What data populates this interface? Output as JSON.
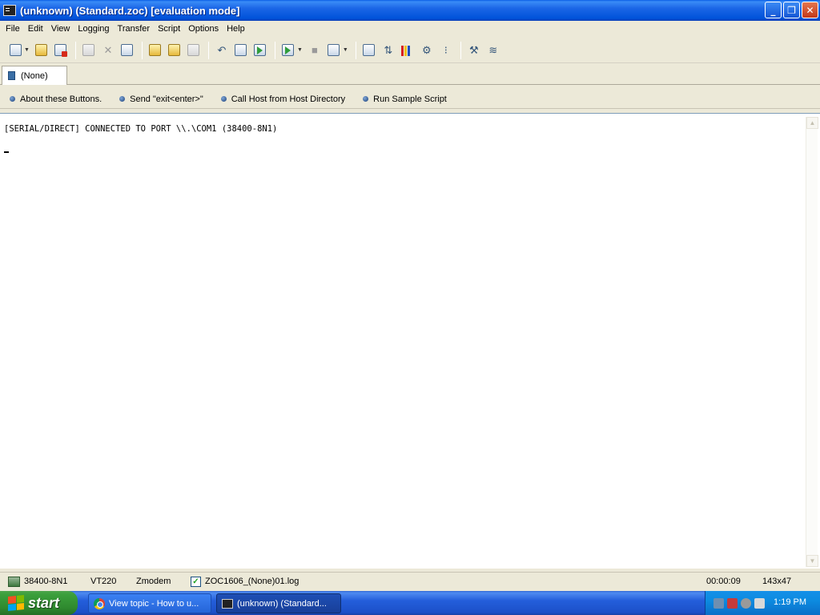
{
  "window": {
    "title": "(unknown) (Standard.zoc) [evaluation mode]",
    "controls": [
      "minimize",
      "restore",
      "close"
    ]
  },
  "menu": [
    "File",
    "Edit",
    "View",
    "Logging",
    "Transfer",
    "Script",
    "Options",
    "Help"
  ],
  "toolbar": {
    "icons": [
      "quick-connect-icon",
      "address-book-icon",
      "disconnect-icon",
      "copy-icon",
      "cut-icon",
      "paste-icon",
      "paste-clipboard-icon",
      "edit-icon",
      "print-icon",
      "send-file-icon",
      "upload-icon",
      "download-icon",
      "run-script-icon",
      "stop-icon",
      "edit-script-icon",
      "settings-icon",
      "transfer-settings-icon",
      "color-settings-icon",
      "keyboard-settings-icon",
      "mapping-icon",
      "tools-icon",
      "trace-icon"
    ]
  },
  "tabs": [
    {
      "label": "(None)"
    }
  ],
  "quick_buttons": [
    {
      "label": "About these Buttons."
    },
    {
      "label": "Send \"exit<enter>\""
    },
    {
      "label": "Call Host from Host Directory"
    },
    {
      "label": "Run Sample Script"
    }
  ],
  "terminal": {
    "lines": [
      "[SERIAL/DIRECT] CONNECTED TO PORT \\\\.\\COM1 (38400-8N1)"
    ]
  },
  "status": {
    "connection": "38400-8N1",
    "emulation": "VT220",
    "protocol": "Zmodem",
    "log_enabled": true,
    "log_file": "ZOC1606_(None)01.log",
    "timer": "00:00:09",
    "size": "143x47"
  },
  "taskbar": {
    "start_label": "start",
    "items": [
      {
        "label": "View topic - How to u..."
      },
      {
        "label": "(unknown) (Standard..."
      }
    ],
    "clock": "1:19 PM"
  },
  "colors": {
    "titlebar": "#0053da",
    "taskbar": "#245edb",
    "start": "#3b9f3b",
    "chrome": "#ece9d8"
  }
}
